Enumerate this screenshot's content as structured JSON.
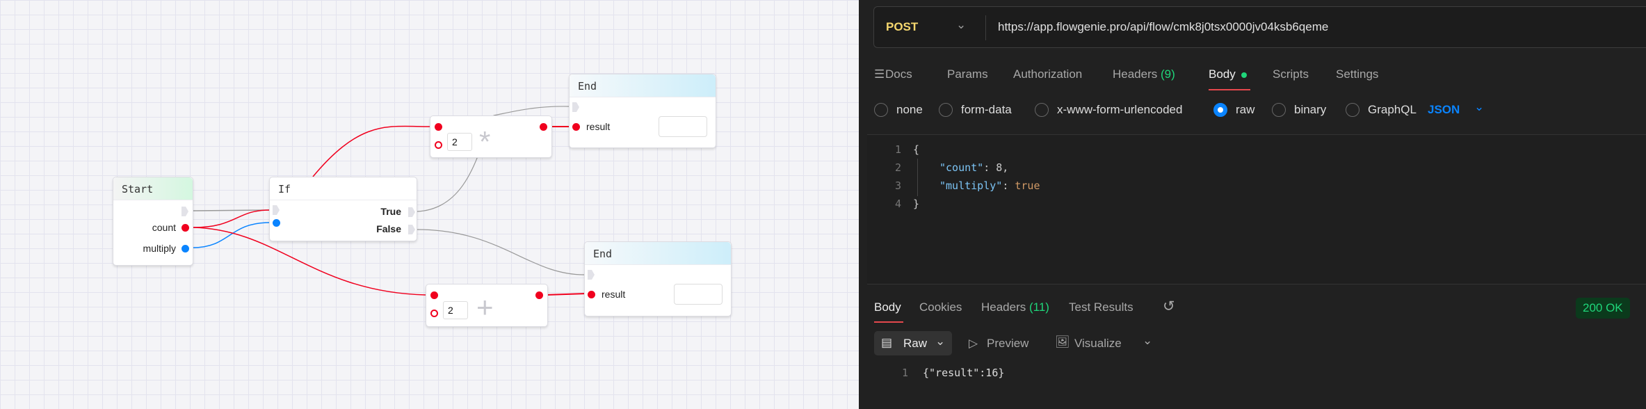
{
  "canvas": {
    "start": {
      "title": "Start",
      "ports": [
        "count",
        "multiply"
      ]
    },
    "if": {
      "title": "If",
      "outputs": [
        "True",
        "False"
      ]
    },
    "multiply_node": {
      "operand": "2",
      "operator": "*"
    },
    "add_node": {
      "operand": "2",
      "operator": "+"
    },
    "end_top": {
      "title": "End",
      "port": "result"
    },
    "end_bottom": {
      "title": "End",
      "port": "result"
    }
  },
  "request": {
    "method": "POST",
    "url": "https://app.flowgenie.pro/api/flow/cmk8j0tsx0000jv04ksb6qeme",
    "tabs": {
      "docs": "Docs",
      "params": "Params",
      "authorization": "Authorization",
      "headers": "Headers",
      "headers_count": "(9)",
      "body": "Body",
      "scripts": "Scripts",
      "settings": "Settings"
    },
    "body_types": [
      "none",
      "form-data",
      "x-www-form-urlencoded",
      "raw",
      "binary",
      "GraphQL"
    ],
    "selected_body_type": "raw",
    "format": "JSON",
    "lines": [
      {
        "n": "1",
        "text": "{"
      },
      {
        "n": "2",
        "key": "\"count\"",
        "sep": ": ",
        "val": "8,"
      },
      {
        "n": "3",
        "key": "\"multiply\"",
        "sep": ": ",
        "val": "true"
      },
      {
        "n": "4",
        "text": "}"
      }
    ]
  },
  "response": {
    "tabs": {
      "body": "Body",
      "cookies": "Cookies",
      "headers": "Headers",
      "headers_count": "(11)",
      "tests": "Test Results"
    },
    "status": "200 OK",
    "views": {
      "raw": "Raw",
      "preview": "Preview",
      "visualize": "Visualize"
    },
    "line_no": "1",
    "body": "{\"result\":16}"
  },
  "colors": {
    "accent": "#0a84ff",
    "port": "#f0001e",
    "ok": "#1fd67a",
    "method": "#f5d76e"
  }
}
